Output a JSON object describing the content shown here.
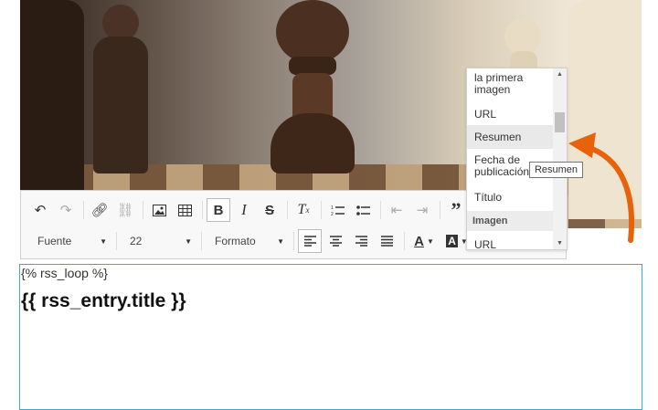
{
  "editor": {
    "toolbar": {
      "font_combo": "Fuente",
      "size_combo": "22",
      "format_combo": "Formato"
    },
    "content": {
      "loop_line": "{% rss_loop %}",
      "title_line": "{{ rss_entry.title }}"
    }
  },
  "dropdown": {
    "items": [
      {
        "label_line1": "la primera",
        "label_line2": "imagen"
      },
      {
        "label": "URL"
      },
      {
        "label": "Resumen"
      },
      {
        "label_line1": "Fecha de",
        "label_line2": "publicación"
      },
      {
        "label": "Título"
      }
    ],
    "group": "Imagen",
    "group_item": "URL"
  },
  "tooltip": "Resumen",
  "colors": {
    "accent_border": "#41a8c9",
    "arrow": "#e8620c"
  }
}
